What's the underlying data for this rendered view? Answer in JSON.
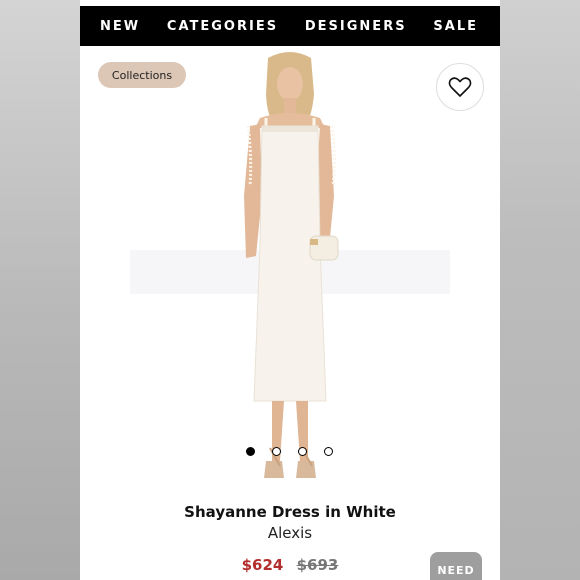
{
  "nav": {
    "items": [
      {
        "label": "NEW"
      },
      {
        "label": "CATEGORIES"
      },
      {
        "label": "DESIGNERS"
      },
      {
        "label": "SALE"
      }
    ]
  },
  "collections_chip": "Collections",
  "favorite_icon": "heart-outline-icon",
  "carousel": {
    "total": 4,
    "active_index": 0
  },
  "product": {
    "name": "Shayanne Dress in White",
    "brand": "Alexis",
    "sale_price": "$624",
    "original_price": "$693"
  },
  "need_button": "NEED",
  "colors": {
    "nav_bg": "#000000",
    "chip_bg": "#dcc6b6",
    "sale_price": "#b32d2d",
    "need_bg": "#9e9e9e"
  }
}
